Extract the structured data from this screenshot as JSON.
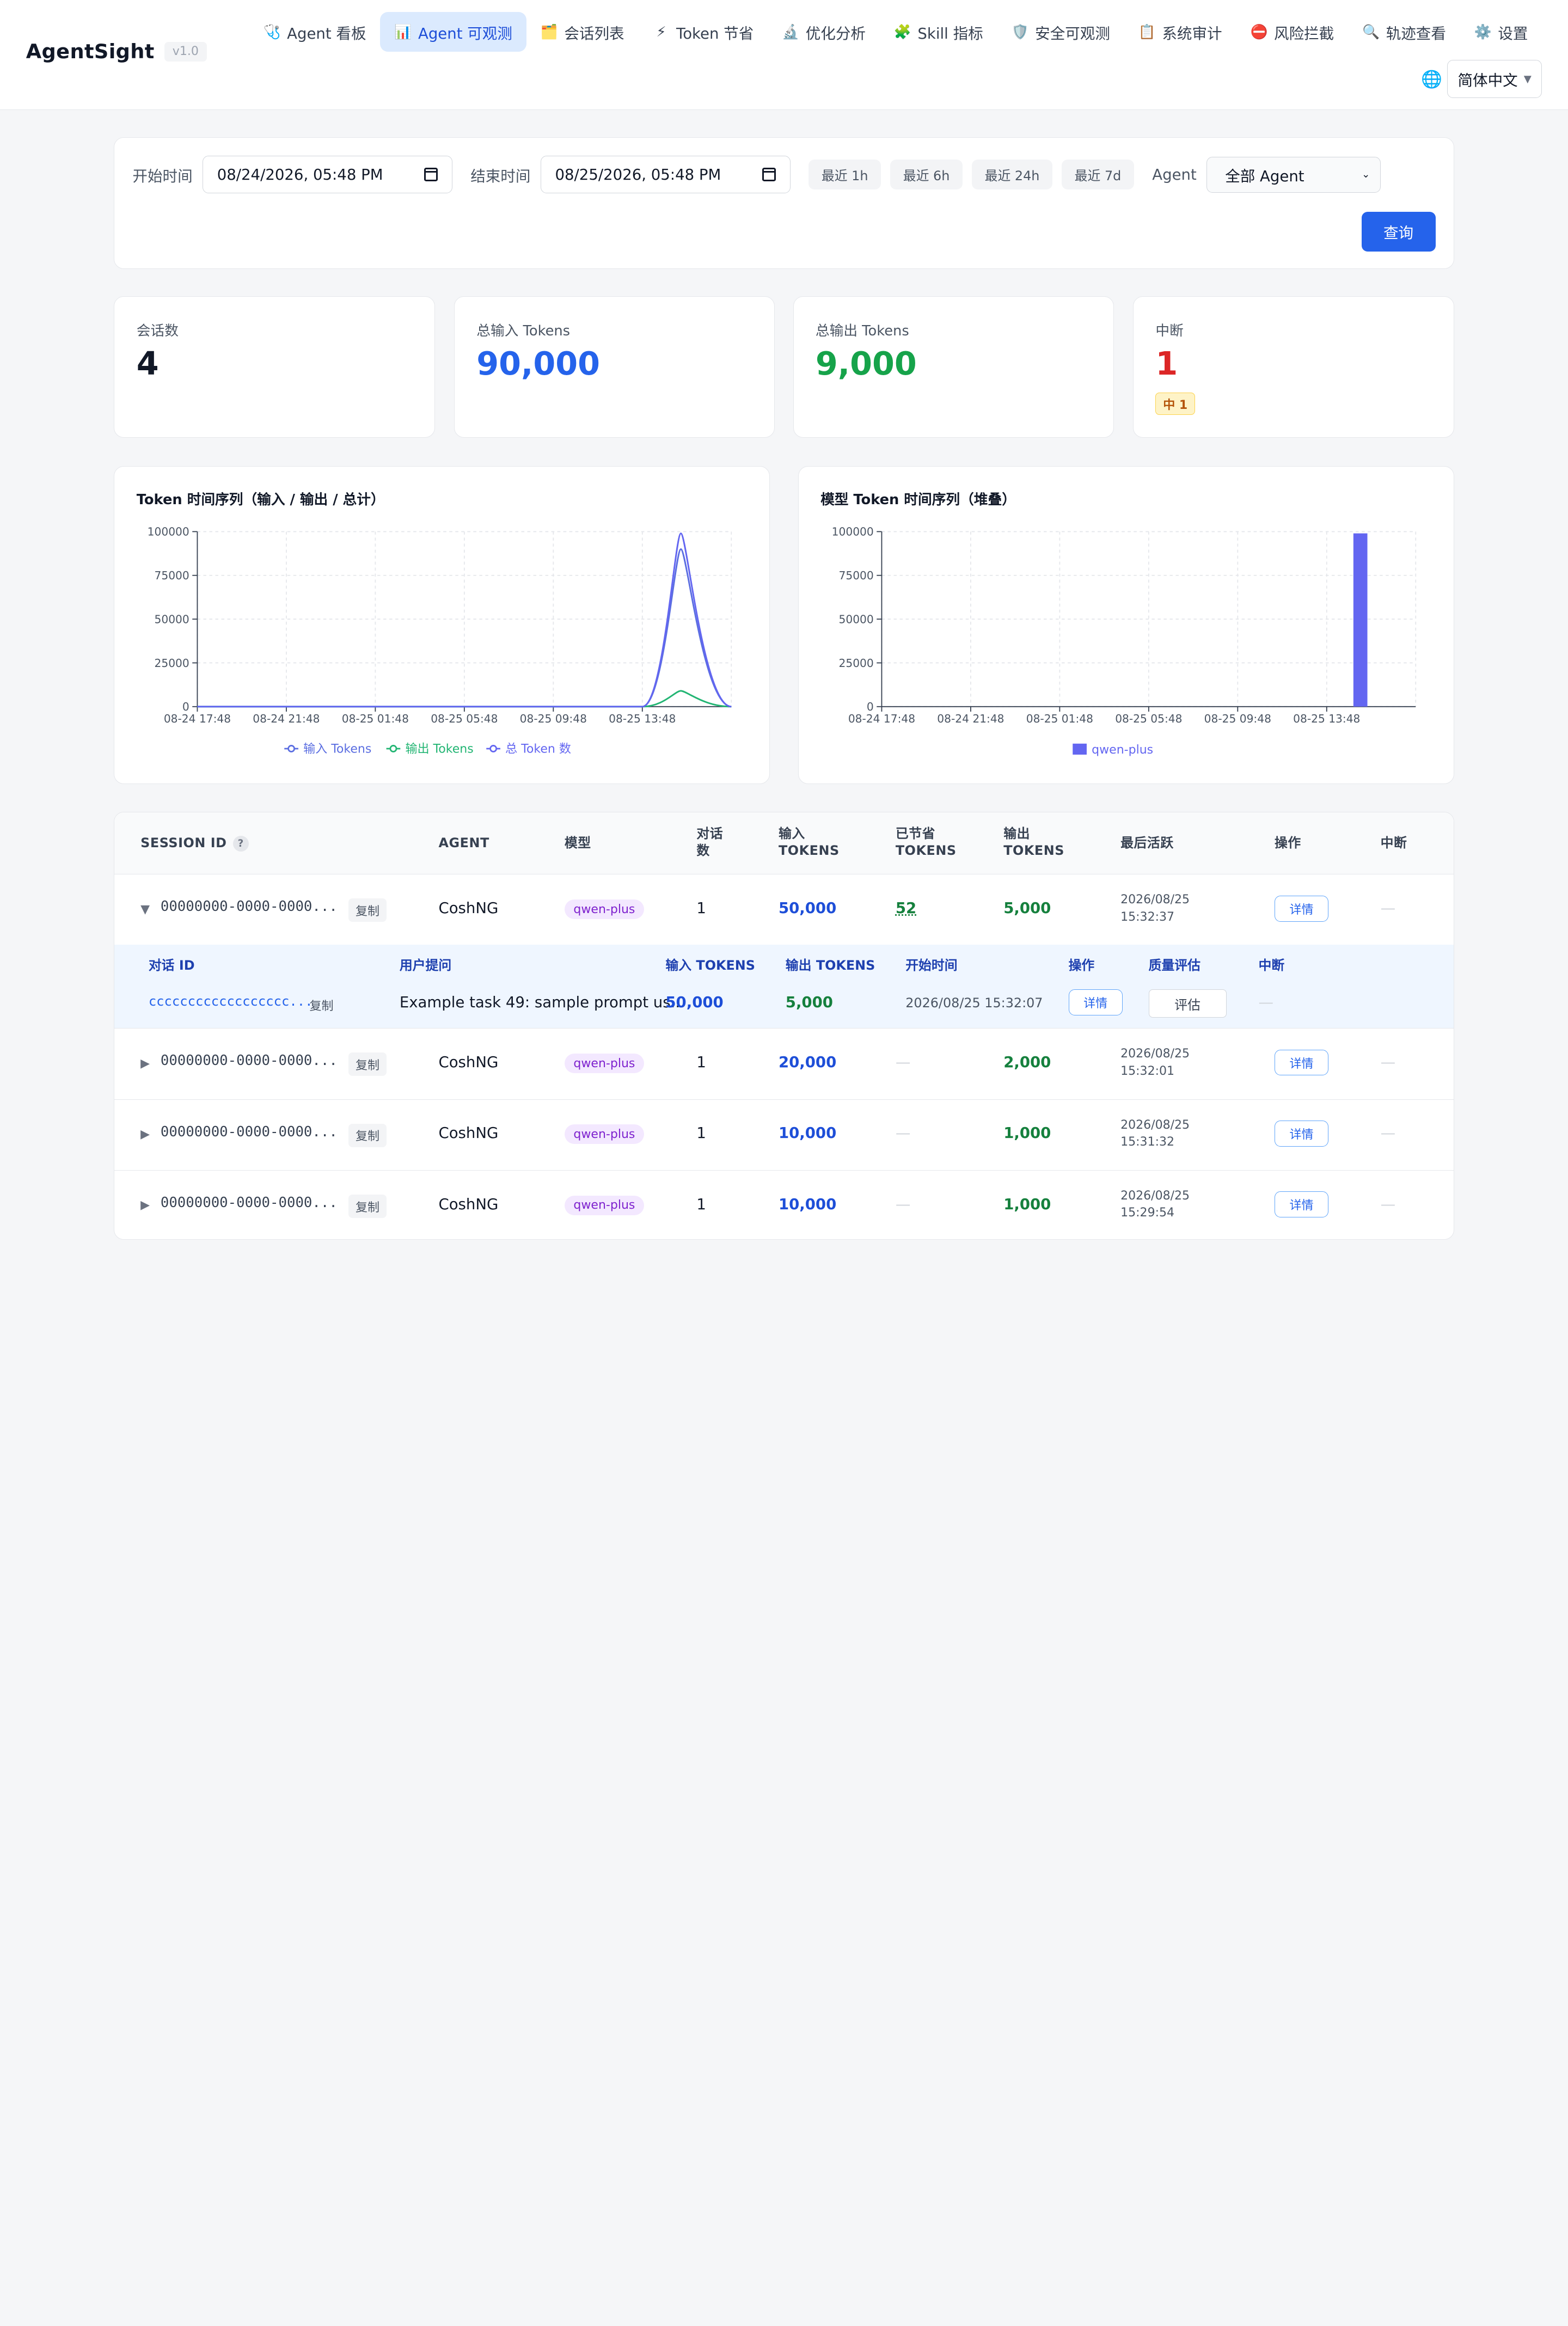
{
  "app": {
    "name": "AgentSight",
    "version": "v1.0"
  },
  "nav": {
    "items": [
      {
        "icon": "🩺",
        "label": "Agent 看板"
      },
      {
        "icon": "📊",
        "label": "Agent 可观测"
      },
      {
        "icon": "🗂️",
        "label": "会话列表"
      },
      {
        "icon": "⚡",
        "label": "Token 节省"
      },
      {
        "icon": "🔬",
        "label": "优化分析"
      },
      {
        "icon": "🧩",
        "label": "Skill 指标"
      },
      {
        "icon": "🛡️",
        "label": "安全可观测"
      },
      {
        "icon": "📋",
        "label": "系统审计"
      },
      {
        "icon": "⛔",
        "label": "风险拦截"
      },
      {
        "icon": "🔍",
        "label": "轨迹查看"
      },
      {
        "icon": "⚙️",
        "label": "设置"
      }
    ],
    "lang_icon": "🌐",
    "lang": "简体中文"
  },
  "filter": {
    "start_label": "开始时间",
    "start_value": "08/24/2026, 05:48 PM",
    "end_label": "结束时间",
    "end_value": "08/25/2026, 05:48 PM",
    "quick": [
      "最近 1h",
      "最近 6h",
      "最近 24h",
      "最近 7d"
    ],
    "agent_label": "Agent",
    "agent_value": "全部 Agent",
    "query": "查询"
  },
  "stats": {
    "sessions": {
      "label": "会话数",
      "value": "4"
    },
    "input_tokens": {
      "label": "总输入 Tokens",
      "value": "90,000"
    },
    "output_tokens": {
      "label": "总输出 Tokens",
      "value": "9,000"
    },
    "interrupts": {
      "label": "中断",
      "value": "1",
      "badge": "中 1"
    }
  },
  "colors": {
    "input": "#5b6ee1",
    "output": "#22b573",
    "total": "#6366f1",
    "bar": "#6366f1",
    "accent": "#2563eb"
  },
  "chart_data": [
    {
      "type": "line",
      "title": "Token 时间序列（输入 / 输出 / 总计）",
      "ylim": [
        0,
        100000
      ],
      "yticks": [
        "0",
        "25000",
        "50000",
        "75000",
        "100000"
      ],
      "xticks": [
        "08-24 17:48",
        "08-24 21:48",
        "08-25 01:48",
        "08-25 05:48",
        "08-25 09:48",
        "08-25 13:48"
      ],
      "x": [
        "08-24 17:48",
        "08-25 13:48",
        "08-25 15:32",
        "08-25 17:48"
      ],
      "series": [
        {
          "name": "输入 Tokens",
          "values": [
            0,
            0,
            90000,
            0
          ]
        },
        {
          "name": "输出 Tokens",
          "values": [
            0,
            0,
            9000,
            0
          ]
        },
        {
          "name": "总 Token 数",
          "values": [
            0,
            0,
            99000,
            0
          ]
        }
      ]
    },
    {
      "type": "bar",
      "title": "模型 Token 时间序列（堆叠）",
      "ylim": [
        0,
        100000
      ],
      "yticks": [
        "0",
        "25000",
        "50000",
        "75000",
        "100000"
      ],
      "xticks": [
        "08-24 17:48",
        "08-24 21:48",
        "08-25 01:48",
        "08-25 05:48",
        "08-25 09:48",
        "08-25 13:48"
      ],
      "x": [
        "08-25 15:00"
      ],
      "series": [
        {
          "name": "qwen-plus",
          "values": [
            99000
          ]
        }
      ]
    }
  ],
  "table": {
    "headers": {
      "session_id": "SESSION ID",
      "help": "?",
      "agent": "AGENT",
      "model": "模型",
      "turns": "对话\n数",
      "input": "输入\nTOKENS",
      "saved": "已节省\nTOKENS",
      "output": "输出\nTOKENS",
      "last": "最后活跃",
      "ops": "操作",
      "interrupt": "中断"
    },
    "copy_label": "复制",
    "detail_label": "详情",
    "rows": [
      {
        "expand": "▼",
        "session_id": "00000000-0000-0000...",
        "agent": "CoshNG",
        "model": "qwen-plus",
        "turns": "1",
        "input": "50,000",
        "saved": "52",
        "output": "5,000",
        "last_date": "2026/08/25",
        "last_time": "15:32:37",
        "interrupt": "—"
      },
      {
        "expand": "▶",
        "session_id": "00000000-0000-0000...",
        "agent": "CoshNG",
        "model": "qwen-plus",
        "turns": "1",
        "input": "20,000",
        "saved": "—",
        "output": "2,000",
        "last_date": "2026/08/25",
        "last_time": "15:32:01",
        "interrupt": "—"
      },
      {
        "expand": "▶",
        "session_id": "00000000-0000-0000...",
        "agent": "CoshNG",
        "model": "qwen-plus",
        "turns": "1",
        "input": "10,000",
        "saved": "—",
        "output": "1,000",
        "last_date": "2026/08/25",
        "last_time": "15:31:32",
        "interrupt": "—"
      },
      {
        "expand": "▶",
        "session_id": "00000000-0000-0000...",
        "agent": "CoshNG",
        "model": "qwen-plus",
        "turns": "1",
        "input": "10,000",
        "saved": "—",
        "output": "1,000",
        "last_date": "2026/08/25",
        "last_time": "15:29:54",
        "interrupt": "—"
      }
    ],
    "sub": {
      "headers": {
        "conv_id": "对话 ID",
        "question": "用户提问",
        "input": "输入 TOKENS",
        "output": "输出 TOKENS",
        "start": "开始时间",
        "ops": "操作",
        "quality": "质量评估",
        "interrupt": "中断"
      },
      "row": {
        "conv_id": "cccccccccccccccccc...",
        "question": "Example task 49: sample prompt us...",
        "input": "50,000",
        "output": "5,000",
        "start": "2026/08/25 15:32:07",
        "detail": "详情",
        "eval": "评估",
        "interrupt": "—"
      }
    }
  }
}
